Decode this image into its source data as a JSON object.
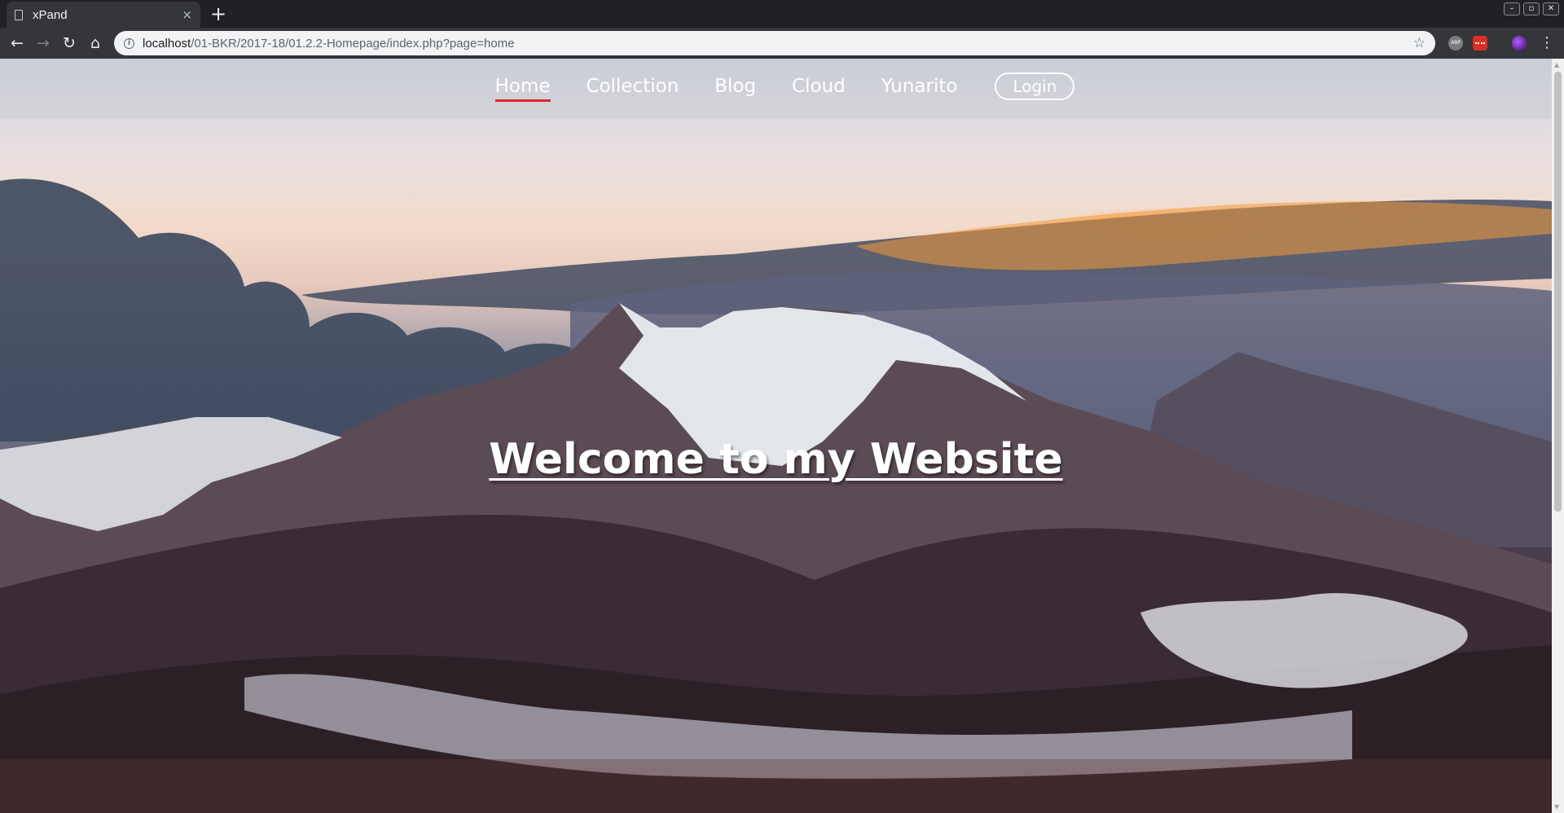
{
  "browser": {
    "tab_title": "xPand",
    "tab_close": "×",
    "new_tab": "+",
    "url_host": "localhost",
    "url_path": "/01-BKR/2017-18/01.2.2-Homepage/index.php?page=home",
    "window_controls": [
      "–",
      "▫",
      "✕"
    ],
    "icons": [
      "back-arrow-icon",
      "forward-arrow-icon",
      "reload-icon",
      "home-icon",
      "info-icon",
      "bookmark-star-icon",
      "menu-icon"
    ]
  },
  "site": {
    "nav": {
      "items": [
        {
          "label": "Home",
          "active": true
        },
        {
          "label": "Collection",
          "active": false
        },
        {
          "label": "Blog",
          "active": false
        },
        {
          "label": "Cloud",
          "active": false
        },
        {
          "label": "Yunarito",
          "active": false
        }
      ],
      "login_label": "Login"
    },
    "headline": "Welcome to my Website"
  },
  "colors": {
    "active_underline": "#e0262b",
    "chrome_dark": "#202124",
    "toolbar": "#35363a"
  }
}
